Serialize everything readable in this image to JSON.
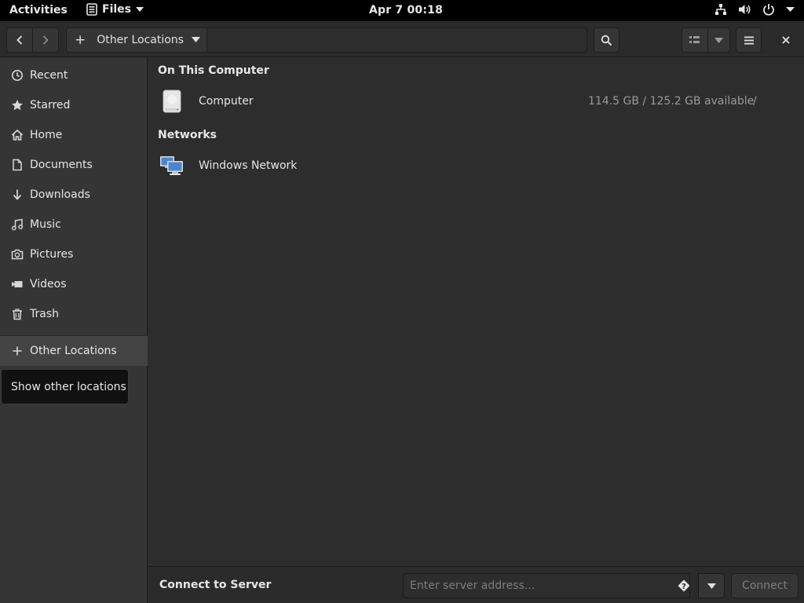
{
  "topbar": {
    "activities": "Activities",
    "app_name": "Files",
    "clock": "Apr 7  00:18",
    "icons": [
      "network-icon",
      "volume-icon",
      "power-icon",
      "system-menu-chevron-icon"
    ]
  },
  "headerbar": {
    "path_label": "Other Locations",
    "location_value": "",
    "icons": [
      "go-back-icon",
      "go-forward-icon",
      "plus-icon",
      "chevron-down-icon",
      "search-icon",
      "view-list-icon",
      "chevron-down-icon",
      "hamburger-menu-icon",
      "close-icon"
    ]
  },
  "sidebar": {
    "items": [
      {
        "label": "Recent",
        "icon": "clock-icon"
      },
      {
        "label": "Starred",
        "icon": "star-icon"
      },
      {
        "label": "Home",
        "icon": "home-icon"
      },
      {
        "label": "Documents",
        "icon": "document-icon"
      },
      {
        "label": "Downloads",
        "icon": "download-icon"
      },
      {
        "label": "Music",
        "icon": "music-icon"
      },
      {
        "label": "Pictures",
        "icon": "camera-icon"
      },
      {
        "label": "Videos",
        "icon": "video-icon"
      },
      {
        "label": "Trash",
        "icon": "trash-icon"
      }
    ],
    "other_locations": {
      "label": "Other Locations",
      "icon": "plus-icon",
      "active": true
    },
    "tooltip": "Show other locations"
  },
  "main": {
    "sections": [
      {
        "title": "On This Computer",
        "rows": [
          {
            "name": "Computer",
            "available": "114.5 GB / 125.2 GB available",
            "mount": "/",
            "icon": "drive-harddisk-icon"
          }
        ]
      },
      {
        "title": "Networks",
        "rows": [
          {
            "name": "Windows Network",
            "icon": "network-workgroup-icon"
          }
        ]
      }
    ]
  },
  "connect": {
    "title": "Connect to Server",
    "placeholder": "Enter server address...",
    "value": "",
    "button": "Connect",
    "icons": [
      "help-icon",
      "chevron-down-icon"
    ]
  },
  "colors": {
    "topbar_bg": "#000000",
    "headerbar_bg": "#2b2b2b",
    "sidebar_bg": "#353535",
    "sidebar_active_bg": "#444444",
    "main_bg": "#2d2d2d",
    "text": "#e6e6e6",
    "dim_text": "#9a9a9a",
    "tooltip_bg": "#111111",
    "network_icon_blue": "#4a86cf"
  }
}
